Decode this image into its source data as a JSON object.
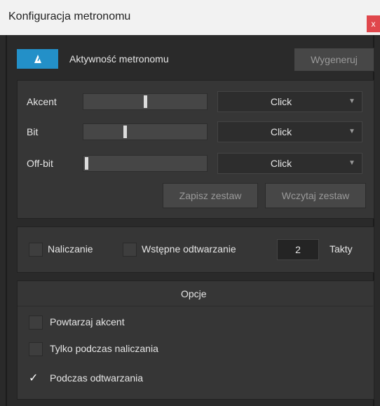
{
  "window": {
    "title": "Konfiguracja metronomu",
    "close_label": "x"
  },
  "top_row": {
    "activity_label": "Aktywność metronomu",
    "regenerate_label": "Wygeneruj"
  },
  "sound_rows": [
    {
      "label": "Akcent",
      "slider_value": 0.5,
      "sound": "Click"
    },
    {
      "label": "Bit",
      "slider_value": 0.33,
      "sound": "Click"
    },
    {
      "label": "Off-bit",
      "slider_value": 0.0,
      "sound": "Click"
    }
  ],
  "preset_buttons": {
    "save_label": "Zapisz zestaw",
    "load_label": "Wczytaj zestaw"
  },
  "count_in": {
    "count_label": "Naliczanie",
    "count_checked": false,
    "preroll_label": "Wstępne odtwarzanie",
    "preroll_checked": false,
    "bars_value": "2",
    "bars_label": "Takty"
  },
  "options": {
    "header": "Opcje",
    "items": [
      {
        "label": "Powtarzaj akcent",
        "checked": false
      },
      {
        "label": "Tylko podczas naliczania",
        "checked": false
      },
      {
        "label": "Podczas odtwarzania",
        "checked": true
      }
    ]
  },
  "colors": {
    "accent": "#2390c8",
    "close": "#e0474c",
    "background": "#2a2a2a"
  },
  "icons": {
    "toggle_icon": "metronome-icon",
    "dropdown_icon": "chevron-down-icon",
    "check_icon": "checkmark-icon"
  }
}
